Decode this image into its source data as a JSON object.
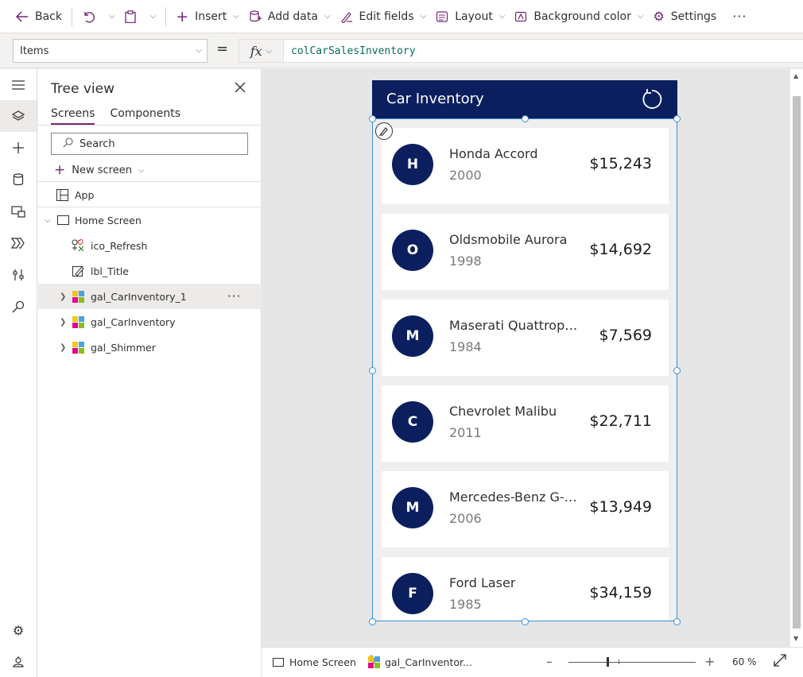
{
  "commandbar": {
    "back_label": "Back",
    "insert_label": "Insert",
    "add_data_label": "Add data",
    "edit_fields_label": "Edit fields",
    "layout_label": "Layout",
    "background_color_label": "Background color",
    "settings_label": "Settings",
    "more_label": "···"
  },
  "formula_bar": {
    "property": "Items",
    "equals": "=",
    "fx": "fx",
    "formula": "colCarSalesInventory"
  },
  "tree_view": {
    "title": "Tree view",
    "tabs": [
      "Screens",
      "Components"
    ],
    "search_placeholder": "Search",
    "new_screen_label": "New screen",
    "nodes": {
      "app": "App",
      "home_screen": "Home Screen",
      "ico_refresh": "ico_Refresh",
      "lbl_title": "lbl_Title",
      "gal_carinventory_1": "gal_CarInventory_1",
      "gal_carinventory": "gal_CarInventory",
      "gal_shimmer": "gal_Shimmer"
    },
    "more_label": "···"
  },
  "app_preview": {
    "title": "Car Inventory",
    "header_color": "#0b1f5f",
    "cars": [
      {
        "initial": "H",
        "name": "Honda Accord",
        "year": "2000",
        "price": "$15,243"
      },
      {
        "initial": "O",
        "name": "Oldsmobile Aurora",
        "year": "1998",
        "price": "$14,692"
      },
      {
        "initial": "M",
        "name": "Maserati Quattropo...",
        "year": "1984",
        "price": "$7,569"
      },
      {
        "initial": "C",
        "name": "Chevrolet Malibu",
        "year": "2011",
        "price": "$22,711"
      },
      {
        "initial": "M",
        "name": "Mercedes-Benz G-Cl...",
        "year": "2006",
        "price": "$13,949"
      },
      {
        "initial": "F",
        "name": "Ford Laser",
        "year": "1985",
        "price": "$34,159"
      }
    ]
  },
  "status_bar": {
    "screen_crumb": "Home Screen",
    "gallery_crumb": "gal_CarInventor...",
    "zoom_value": "60",
    "zoom_unit": "%"
  },
  "theme": {
    "accent": "#742774",
    "selection": "#3a8dde"
  }
}
